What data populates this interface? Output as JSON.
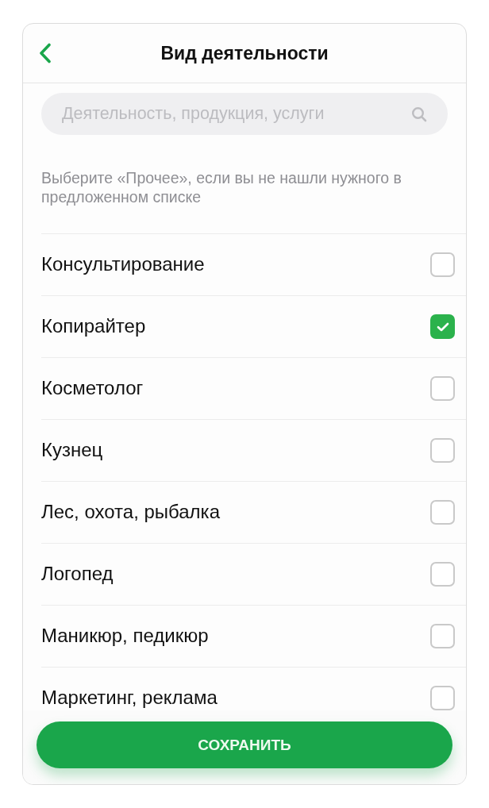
{
  "header": {
    "title": "Вид деятельности"
  },
  "search": {
    "placeholder": "Деятельность, продукция, услуги"
  },
  "hint": "Выберите «Прочее», если вы не нашли нужного в предложенном списке",
  "activities": [
    {
      "label": "Консультирование",
      "checked": false
    },
    {
      "label": "Копирайтер",
      "checked": true
    },
    {
      "label": "Косметолог",
      "checked": false
    },
    {
      "label": "Кузнец",
      "checked": false
    },
    {
      "label": "Лес, охота, рыбалка",
      "checked": false
    },
    {
      "label": "Логопед",
      "checked": false
    },
    {
      "label": "Маникюр, педикюр",
      "checked": false
    },
    {
      "label": "Маркетинг, реклама",
      "checked": false
    }
  ],
  "save_button": {
    "label": "СОХРАНИТЬ"
  }
}
